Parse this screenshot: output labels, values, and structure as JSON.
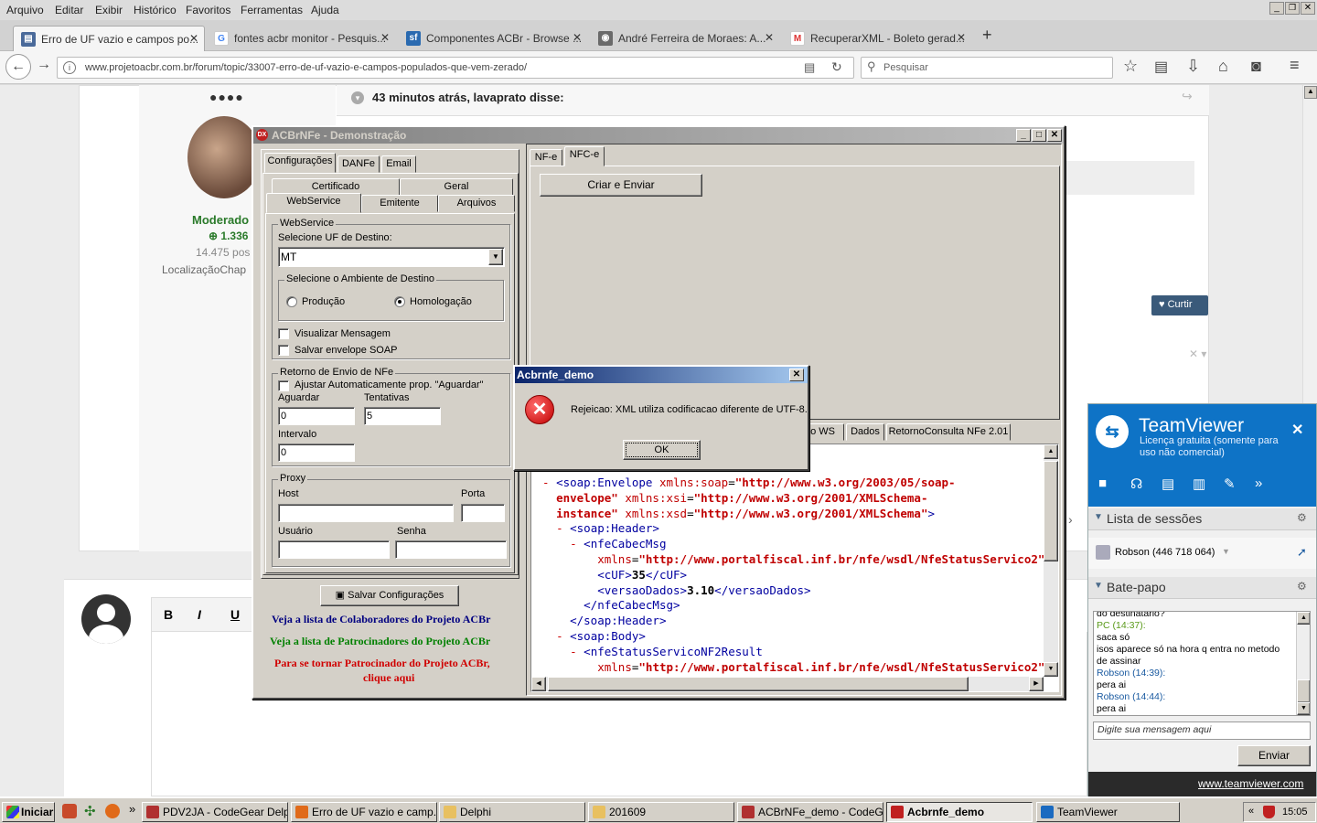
{
  "browser": {
    "menu": [
      "Arquivo",
      "Editar",
      "Exibir",
      "Histórico",
      "Favoritos",
      "Ferramentas",
      "Ajuda"
    ],
    "tabs": [
      {
        "label": "Erro de UF vazio e campos po...",
        "active": true
      },
      {
        "label": "fontes acbr monitor - Pesquis..."
      },
      {
        "label": "Componentes ACBr - Browse ..."
      },
      {
        "label": "André Ferreira de Moraes: A..."
      },
      {
        "label": "RecuperarXML - Boleto gerad..."
      }
    ],
    "url": "www.projetoacbr.com.br/forum/topic/33007-erro-de-uf-vazio-e-campos-populados-que-vem-zerado/",
    "search_placeholder": "Pesquisar"
  },
  "forum": {
    "quote_header": "43 minutos atrás, lavaprato disse:",
    "user_dots": "●●●●",
    "role": "Moderado",
    "reputation": "1.336",
    "posts": "14.475 pos",
    "location": "LocalizaçãoChap",
    "like_label": "Curtir",
    "editor_buttons": [
      "B",
      "I",
      "U"
    ]
  },
  "acbr": {
    "title": "ACBrNFe - Demonstração",
    "top_tabs": [
      "Configurações",
      "DANFe",
      "Email"
    ],
    "sub_tabs_row1": [
      "Certificado",
      "Geral"
    ],
    "sub_tabs_row2": [
      "WebService",
      "Emitente",
      "Arquivos"
    ],
    "ws_group": "WebService",
    "uf_label": "Selecione UF de Destino:",
    "uf_value": "MT",
    "amb_group": "Selecione o Ambiente de Destino",
    "radio_prod": "Produção",
    "radio_homo": "Homologação",
    "chk_visualizar": "Visualizar Mensagem",
    "chk_salvar_soap": "Salvar envelope SOAP",
    "retorno_group": "Retorno de Envio de NFe",
    "chk_ajustar": "Ajustar Automaticamente prop. \"Aguardar\"",
    "aguardar_label": "Aguardar",
    "aguardar_value": "0",
    "tentativas_label": "Tentativas",
    "tentativas_value": "5",
    "intervalo_label": "Intervalo",
    "intervalo_value": "0",
    "proxy_group": "Proxy",
    "host_label": "Host",
    "porta_label": "Porta",
    "usuario_label": "Usuário",
    "senha_label": "Senha",
    "salvar_btn": "Salvar Configurações",
    "link_colab": "Veja a lista de Colaboradores do Projeto ACBr",
    "link_patroc": "Veja a lista de Patrocinadores do Projeto ACBr",
    "link_tornar": "Para se tornar Patrocinador do Projeto ACBr,",
    "link_tornar2": "clique aqui",
    "right_tabs": [
      "NF-e",
      "NFC-e"
    ],
    "criar_btn": "Criar e Enviar",
    "result_tabs": [
      "eto WS",
      "Dados",
      "RetornoConsulta NFe 2.01"
    ]
  },
  "dialog": {
    "title": "Acbrnfe_demo",
    "message": "Rejeicao: XML utiliza codificacao diferente de UTF-8.",
    "ok": "OK"
  },
  "teamviewer": {
    "brand": "TeamViewer",
    "license": "Licença gratuita (somente para uso não comercial)",
    "sessions_header": "Lista de sessões",
    "session_item": "Robson (446 718 064)",
    "chat_header": "Bate-papo",
    "chat_lines": [
      {
        "t": "do destinatário?",
        "c": "#000"
      },
      {
        "t": "PC (14:37):",
        "c": "#5a9a1a"
      },
      {
        "t": "saca só",
        "c": "#000"
      },
      {
        "t": "isos aparece só na hora q entra no metodo",
        "c": "#000"
      },
      {
        "t": "de assinar",
        "c": "#000"
      },
      {
        "t": "Robson (14:39):",
        "c": "#1a5aa0"
      },
      {
        "t": "pera ai",
        "c": "#000"
      },
      {
        "t": "Robson (14:44):",
        "c": "#1a5aa0"
      },
      {
        "t": "pera ai",
        "c": "#000"
      }
    ],
    "input_placeholder": "Digite sua mensagem aqui",
    "send": "Enviar",
    "link": "www.teamviewer.com"
  },
  "taskbar": {
    "start": "Iniciar",
    "items": [
      {
        "label": "PDV2JA - CodeGear Delp...",
        "color": "#b03030"
      },
      {
        "label": "Erro de UF vazio e camp...",
        "color": "#e06a1a"
      },
      {
        "label": "Delphi",
        "color": "#e8c060"
      },
      {
        "label": "201609",
        "color": "#e8c060"
      },
      {
        "label": "ACBrNFe_demo - CodeG...",
        "color": "#b03030"
      },
      {
        "label": "Acbrnfe_demo",
        "color": "#c02020",
        "active": true
      },
      {
        "label": "TeamViewer",
        "color": "#1a6ac0"
      }
    ],
    "clock": "15:05"
  }
}
